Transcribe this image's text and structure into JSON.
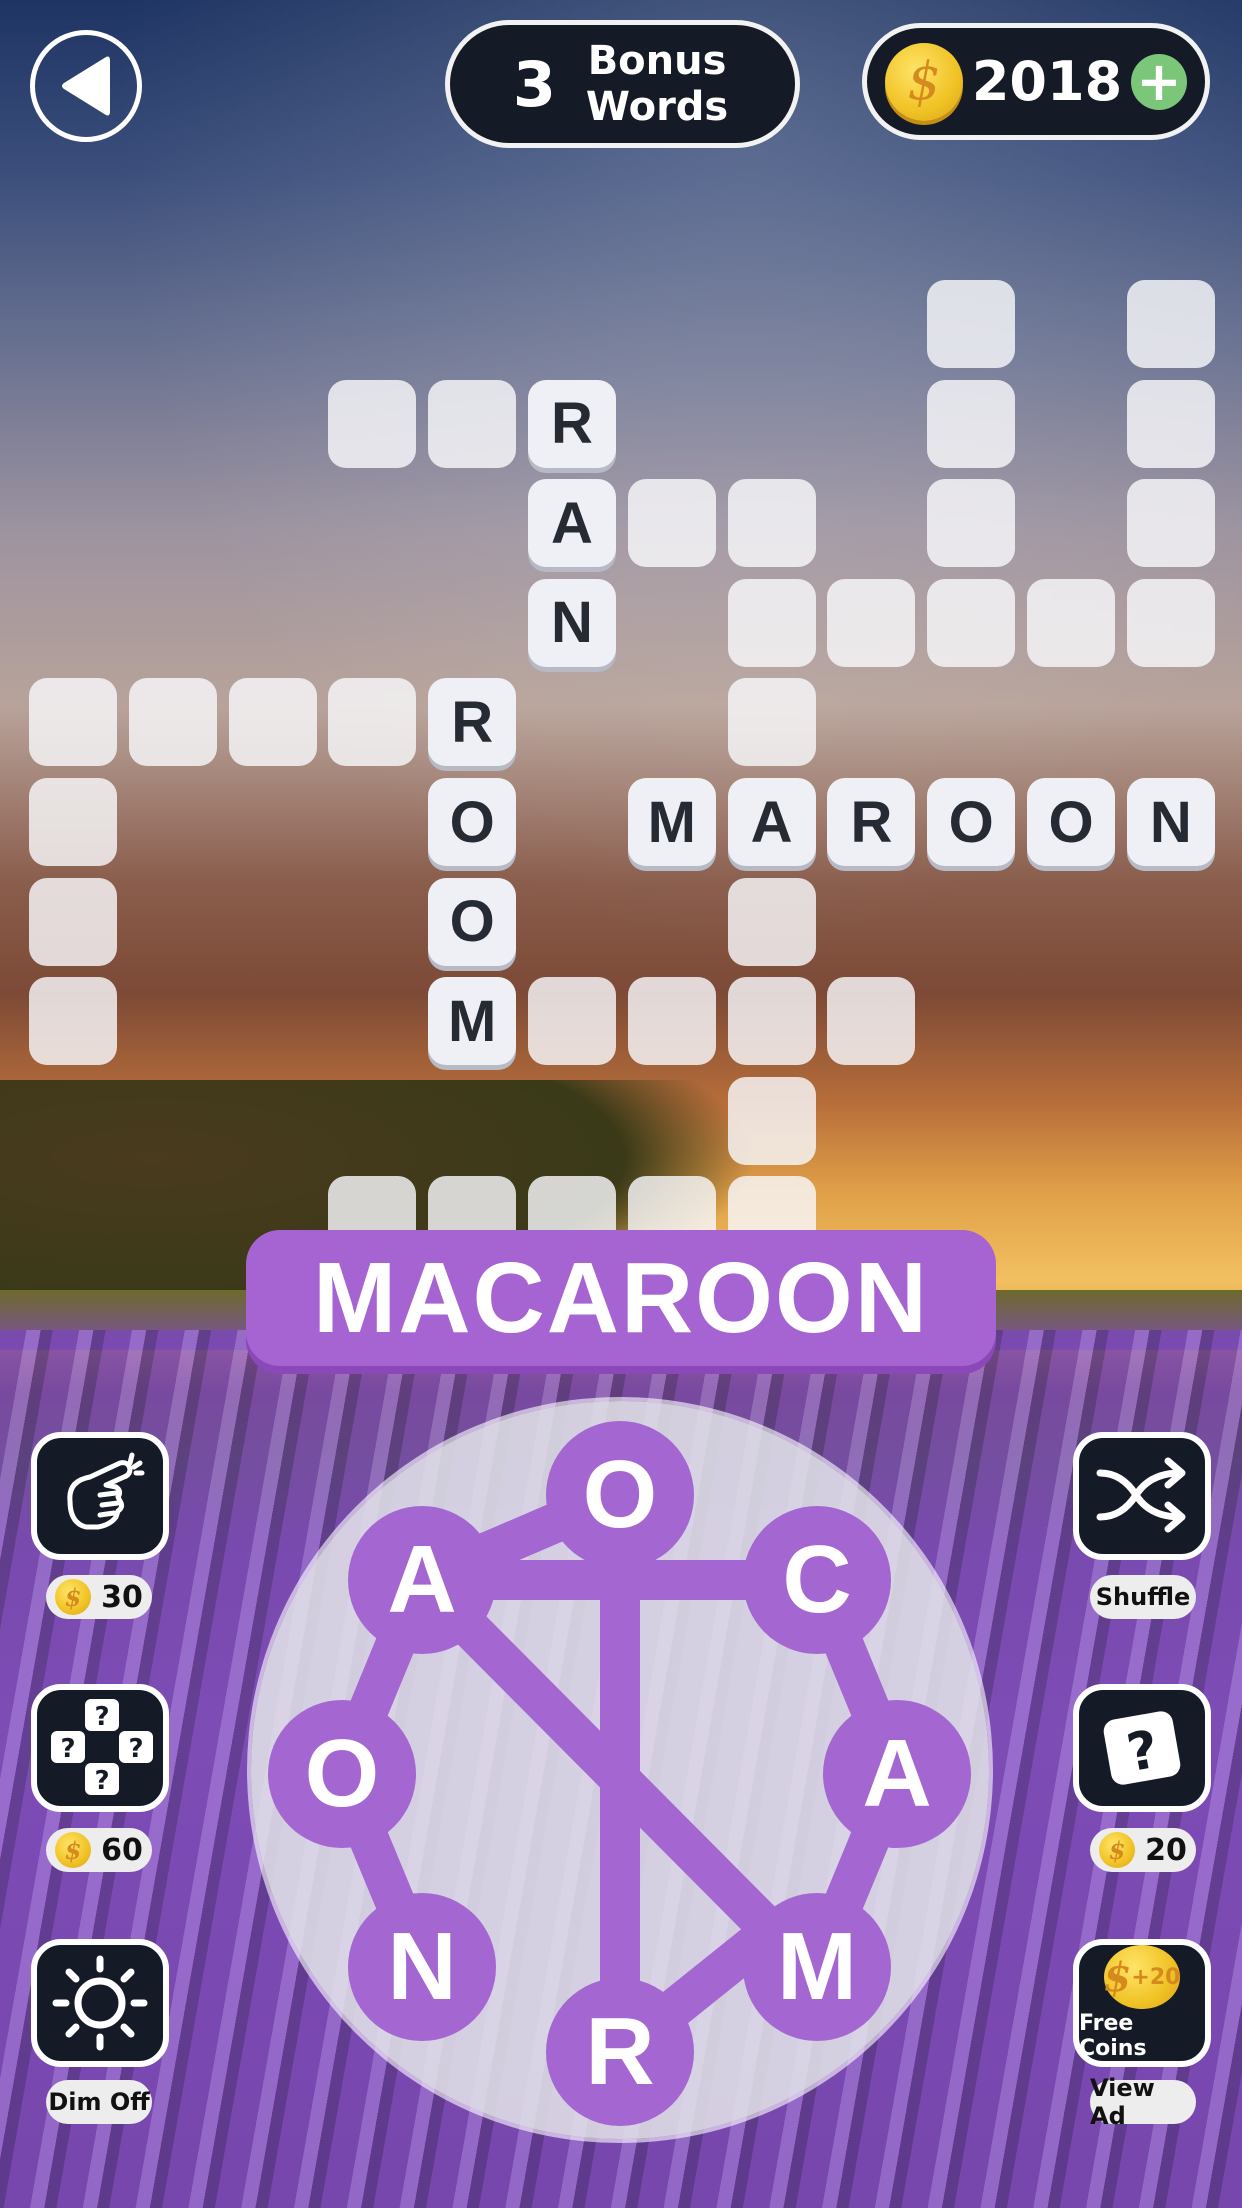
{
  "header": {
    "back_icon": "back-arrow-icon",
    "bonus_count": "3",
    "bonus_label": "Bonus Words",
    "coins": "2018",
    "coin_icon": "dollar-coin-icon",
    "add_coins_icon": "plus-icon"
  },
  "grid": {
    "cells": [
      {
        "r": 0,
        "c": 9,
        "l": ""
      },
      {
        "r": 0,
        "c": 11,
        "l": ""
      },
      {
        "r": 1,
        "c": 3,
        "l": ""
      },
      {
        "r": 1,
        "c": 4,
        "l": ""
      },
      {
        "r": 1,
        "c": 5,
        "l": "R"
      },
      {
        "r": 1,
        "c": 9,
        "l": ""
      },
      {
        "r": 1,
        "c": 11,
        "l": ""
      },
      {
        "r": 2,
        "c": 5,
        "l": "A"
      },
      {
        "r": 2,
        "c": 6,
        "l": ""
      },
      {
        "r": 2,
        "c": 7,
        "l": ""
      },
      {
        "r": 2,
        "c": 9,
        "l": ""
      },
      {
        "r": 2,
        "c": 11,
        "l": ""
      },
      {
        "r": 3,
        "c": 5,
        "l": "N"
      },
      {
        "r": 3,
        "c": 7,
        "l": ""
      },
      {
        "r": 3,
        "c": 8,
        "l": ""
      },
      {
        "r": 3,
        "c": 9,
        "l": ""
      },
      {
        "r": 3,
        "c": 10,
        "l": ""
      },
      {
        "r": 3,
        "c": 11,
        "l": ""
      },
      {
        "r": 4,
        "c": 0,
        "l": ""
      },
      {
        "r": 4,
        "c": 1,
        "l": ""
      },
      {
        "r": 4,
        "c": 2,
        "l": ""
      },
      {
        "r": 4,
        "c": 3,
        "l": ""
      },
      {
        "r": 4,
        "c": 4,
        "l": "R"
      },
      {
        "r": 4,
        "c": 7,
        "l": ""
      },
      {
        "r": 5,
        "c": 0,
        "l": ""
      },
      {
        "r": 5,
        "c": 4,
        "l": "O"
      },
      {
        "r": 5,
        "c": 6,
        "l": "M"
      },
      {
        "r": 5,
        "c": 7,
        "l": "A"
      },
      {
        "r": 5,
        "c": 8,
        "l": "R"
      },
      {
        "r": 5,
        "c": 9,
        "l": "O"
      },
      {
        "r": 5,
        "c": 10,
        "l": "O"
      },
      {
        "r": 5,
        "c": 11,
        "l": "N"
      },
      {
        "r": 6,
        "c": 0,
        "l": ""
      },
      {
        "r": 6,
        "c": 4,
        "l": "O"
      },
      {
        "r": 6,
        "c": 7,
        "l": ""
      },
      {
        "r": 7,
        "c": 0,
        "l": ""
      },
      {
        "r": 7,
        "c": 4,
        "l": "M"
      },
      {
        "r": 7,
        "c": 5,
        "l": ""
      },
      {
        "r": 7,
        "c": 6,
        "l": ""
      },
      {
        "r": 7,
        "c": 7,
        "l": ""
      },
      {
        "r": 7,
        "c": 8,
        "l": ""
      },
      {
        "r": 8,
        "c": 7,
        "l": ""
      },
      {
        "r": 9,
        "c": 3,
        "l": ""
      },
      {
        "r": 9,
        "c": 4,
        "l": ""
      },
      {
        "r": 9,
        "c": 5,
        "l": ""
      },
      {
        "r": 9,
        "c": 6,
        "l": ""
      },
      {
        "r": 9,
        "c": 7,
        "l": ""
      }
    ],
    "found_words": [
      "RAN",
      "ROOM",
      "MAROON"
    ]
  },
  "current_word": "MACAROON",
  "wheel": {
    "letters": [
      "O",
      "C",
      "A",
      "M",
      "R",
      "N",
      "O",
      "A"
    ],
    "selected_path": [
      "M",
      "A",
      "C",
      "A",
      "R",
      "O",
      "O",
      "N"
    ]
  },
  "tools": {
    "hint": {
      "icon": "tap-finger-icon",
      "cost": "30"
    },
    "multi_hint": {
      "icon": "question-tiles-icon",
      "cost": "60"
    },
    "dim": {
      "icon": "sun-icon",
      "label": "Dim Off"
    },
    "shuffle": {
      "icon": "shuffle-icon",
      "label": "Shuffle"
    },
    "reveal": {
      "icon": "question-card-icon",
      "cost": "20"
    },
    "free_coins": {
      "icon": "coin-plus-icon",
      "amount": "+20",
      "label": "Free Coins",
      "action": "View Ad"
    }
  },
  "colors": {
    "accent_purple": "#a564d1",
    "pill_dark": "#141b26",
    "coin_gold": "#f0c224",
    "plus_green": "#7cc67a"
  }
}
